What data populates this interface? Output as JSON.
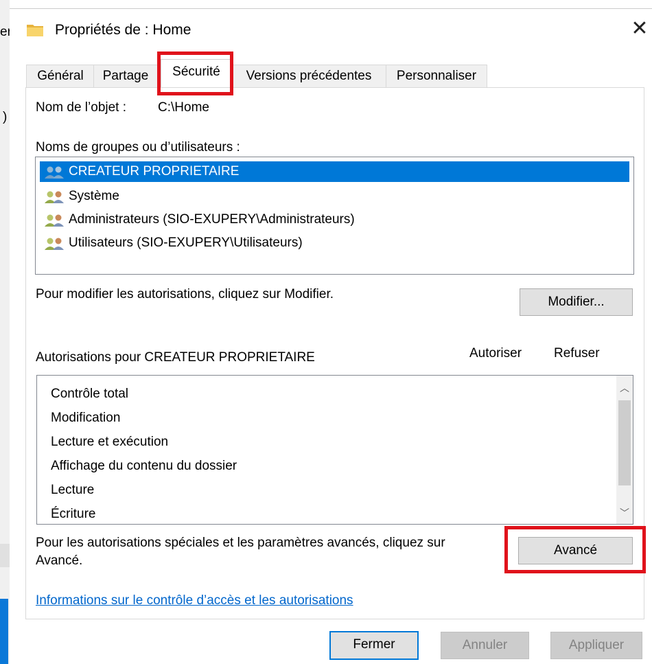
{
  "window": {
    "title": "Propriétés de : Home",
    "close_glyph": "✕"
  },
  "background": {
    "left_fragment_1": "er",
    "left_fragment_2": ")"
  },
  "tabs": [
    {
      "label": "Général"
    },
    {
      "label": "Partage"
    },
    {
      "label": "Sécurité"
    },
    {
      "label": "Versions précédentes"
    },
    {
      "label": "Personnaliser"
    }
  ],
  "security": {
    "object_name_label": "Nom de l’objet :",
    "object_name_value": "C:\\Home",
    "groups_label": "Noms de groupes ou d’utilisateurs :",
    "users": [
      {
        "name": "CREATEUR PROPRIETAIRE",
        "selected": true
      },
      {
        "name": "Système",
        "selected": false
      },
      {
        "name": "Administrateurs (SIO-EXUPERY\\Administrateurs)",
        "selected": false
      },
      {
        "name": "Utilisateurs (SIO-EXUPERY\\Utilisateurs)",
        "selected": false
      }
    ],
    "modify_hint": "Pour modifier les autorisations, cliquez sur Modifier.",
    "modify_button": "Modifier...",
    "permissions_for": "Autorisations pour CREATEUR PROPRIETAIRE",
    "col_allow": "Autoriser",
    "col_deny": "Refuser",
    "permissions": [
      {
        "name": "Contrôle total"
      },
      {
        "name": "Modification"
      },
      {
        "name": "Lecture et exécution"
      },
      {
        "name": "Affichage du contenu du dossier"
      },
      {
        "name": "Lecture"
      },
      {
        "name": "Écriture"
      }
    ],
    "advanced_hint_line1": "Pour les autorisations spéciales et les paramètres avancés, cliquez sur",
    "advanced_hint_line2": "Avancé.",
    "advanced_button": "Avancé",
    "info_link": "Informations sur le contrôle d’accès et les autorisations"
  },
  "footer": {
    "close_button": "Fermer",
    "cancel_button": "Annuler",
    "apply_button": "Appliquer"
  },
  "icons": {
    "scroll_up": "︿",
    "scroll_down": "﹀"
  },
  "colors": {
    "selection": "#0078d7",
    "highlight_box": "#e0121b",
    "link": "#0066cc"
  }
}
